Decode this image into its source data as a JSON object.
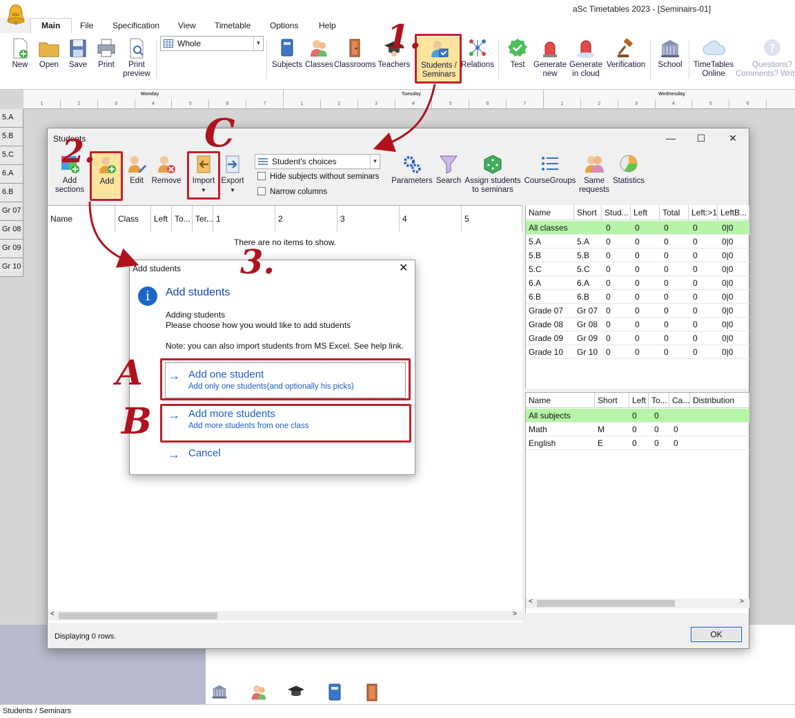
{
  "window": {
    "title": "aSc Timetables 2023  - [Seminairs-01]"
  },
  "menu": [
    "Main",
    "File",
    "Specification",
    "View",
    "Timetable",
    "Options",
    "Help"
  ],
  "ribbon": {
    "new": "New",
    "open": "Open",
    "save": "Save",
    "print": "Print",
    "print_preview_1": "Print",
    "print_preview_2": "preview",
    "view_combo": "Whole",
    "subjects": "Subjects",
    "classes": "Classes",
    "classrooms": "Classrooms",
    "teachers": "Teachers",
    "students_1": "Students /",
    "students_2": "Seminars",
    "relations": "Relations",
    "test": "Test",
    "generate_new_1": "Generate",
    "generate_new_2": "new",
    "generate_cloud_1": "Generate",
    "generate_cloud_2": "in cloud",
    "verification": "Verification",
    "school": "School",
    "tt_online_1": "TimeTables",
    "tt_online_2": "Online",
    "questions_1": "Questions?",
    "questions_2": "Comments? Writ"
  },
  "grid": {
    "days": [
      "Monday",
      "Tuesday",
      "Wednesday"
    ],
    "periods": [
      "1",
      "2",
      "3",
      "4",
      "5",
      "6",
      "7"
    ],
    "classes": [
      "5.A",
      "5.B",
      "5.C",
      "6.A",
      "6.B",
      "Gr 07",
      "Gr 08",
      "Gr 09",
      "Gr 10"
    ]
  },
  "students_window": {
    "title": "Students",
    "toolbar": {
      "add_sections_1": "Add",
      "add_sections_2": "sections",
      "add": "Add",
      "edit": "Edit",
      "remove": "Remove",
      "import": "Import",
      "export": "Export",
      "choices_combo": "Student's choices",
      "hide_subjects": "Hide subjects without seminars",
      "narrow_columns": "Narrow columns",
      "parameters": "Parameters",
      "search": "Search",
      "assign_1": "Assign students",
      "assign_2": "to seminars",
      "coursegroups": "CourseGroups",
      "same_requests_1": "Same",
      "same_requests_2": "requests",
      "statistics": "Statistics"
    },
    "list_columns": [
      "Name",
      "Class",
      "Left",
      "To...",
      "Ter...",
      "1",
      "2",
      "3",
      "4",
      "5"
    ],
    "empty_message": "There are no items to show.",
    "status": "Displaying 0 rows.",
    "ok": "OK",
    "classes_table": {
      "columns": [
        "Name",
        "Short",
        "Stud...",
        "Left",
        "Total",
        "Left:>1",
        "LeftB..."
      ],
      "rows": [
        [
          "All classes",
          "",
          "0",
          "0",
          "0",
          "0",
          "0|0"
        ],
        [
          "5.A",
          "5.A",
          "0",
          "0",
          "0",
          "0",
          "0|0"
        ],
        [
          "5.B",
          "5.B",
          "0",
          "0",
          "0",
          "0",
          "0|0"
        ],
        [
          "5.C",
          "5.C",
          "0",
          "0",
          "0",
          "0",
          "0|0"
        ],
        [
          "6.A",
          "6.A",
          "0",
          "0",
          "0",
          "0",
          "0|0"
        ],
        [
          "6.B",
          "6.B",
          "0",
          "0",
          "0",
          "0",
          "0|0"
        ],
        [
          "Grade 07",
          "Gr 07",
          "0",
          "0",
          "0",
          "0",
          "0|0"
        ],
        [
          "Grade 08",
          "Gr 08",
          "0",
          "0",
          "0",
          "0",
          "0|0"
        ],
        [
          "Grade 09",
          "Gr 09",
          "0",
          "0",
          "0",
          "0",
          "0|0"
        ],
        [
          "Grade 10",
          "Gr 10",
          "0",
          "0",
          "0",
          "0",
          "0|0"
        ]
      ]
    },
    "subjects_table": {
      "columns": [
        "Name",
        "Short",
        "Left",
        "To...",
        "Ca...",
        "Distribution"
      ],
      "rows": [
        [
          "All subjects",
          "",
          "0",
          "0",
          "",
          ""
        ],
        [
          "Math",
          "M",
          "0",
          "0",
          "0",
          ""
        ],
        [
          "English",
          "E",
          "0",
          "0",
          "0",
          ""
        ]
      ]
    }
  },
  "add_dialog": {
    "title": "Add students",
    "heading": "Add students",
    "line1": "Adding students",
    "line2": "Please choose how you would like to add students",
    "note": "Note: you can also import students from MS Excel. See help link.",
    "option_one_title": "Add one student",
    "option_one_desc": "Add only one students(and optionally his picks)",
    "option_more_title": "Add more students",
    "option_more_desc": "Add more students from one class",
    "cancel": "Cancel"
  },
  "annotations": {
    "step1": "1.",
    "step2": "2.",
    "step3": "3.",
    "stepA": "A",
    "stepB": "B",
    "stepC": "C"
  },
  "status_bar": "Students / Seminars",
  "colors": {
    "annotation_red": "#c21f2c",
    "highlight_yellow": "#fde49c",
    "row_highlight_green": "#b6f5a8",
    "link_blue": "#1c5fc0"
  }
}
